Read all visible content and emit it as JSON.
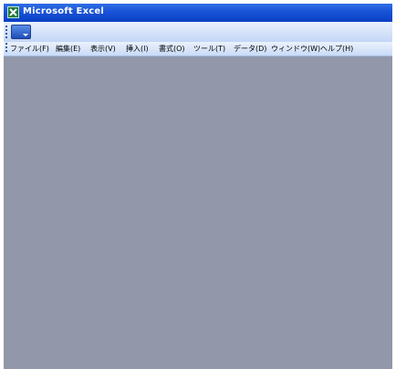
{
  "window": {
    "title": "Microsoft Excel",
    "app_icon": "excel-icon"
  },
  "toolbar": {
    "menu_button_icon": "toolbar-options-icon"
  },
  "menubar": {
    "items": [
      {
        "label": "ファイル(F)"
      },
      {
        "label": "編集(E)"
      },
      {
        "label": "表示(V)"
      },
      {
        "label": "挿入(I)"
      },
      {
        "label": "書式(O)"
      },
      {
        "label": "ツール(T)"
      },
      {
        "label": "データ(D)"
      },
      {
        "label": "ウィンドウ(W)"
      },
      {
        "label": "ヘルプ(H)"
      }
    ]
  },
  "colors": {
    "titlebar": "#1a55d8",
    "workspace": "#9297a9",
    "menubar": "#c9dbf6"
  }
}
